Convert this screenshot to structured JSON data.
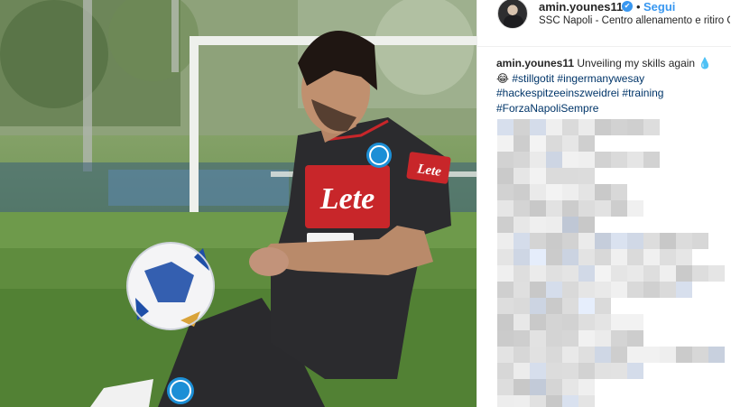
{
  "post": {
    "username": "amin.younes11",
    "verified_glyph": "✔",
    "dot": "•",
    "follow_label": "Segui",
    "location": "SSC Napoli - Centro allenamento e ritiro C..."
  },
  "caption": {
    "username": "amin.younes11",
    "text": "Unveiling my skills again",
    "emoji_1": "💧",
    "emoji_2": "😂",
    "tags_line1": [
      "#stillgotit",
      "#ingermanywesay"
    ],
    "tags_line2": [
      "#hackespitzeeinszweidrei",
      "#training"
    ],
    "tags_line3": [
      "#ForzaNapoliSempre"
    ]
  },
  "photo": {
    "jersey_sponsor": "Lete",
    "sleeve_sponsor": "Lete",
    "colors": {
      "shirt": "#2b2b2e",
      "sponsor_red": "#c8262a",
      "grass": "#5e8a3f",
      "ball_blue": "#1f4fa8",
      "napoli_badge": "#1c8fd6"
    }
  },
  "colors": {
    "link_blue": "#3897f0",
    "hashtag": "#003569",
    "text": "#262626",
    "border": "#efefef"
  }
}
